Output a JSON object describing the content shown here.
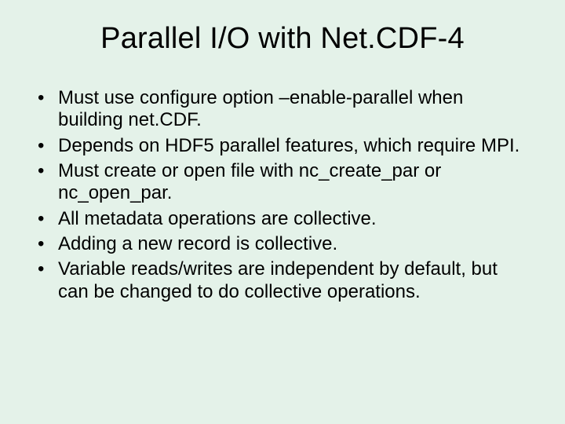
{
  "slide": {
    "title": "Parallel I/O with Net.CDF-4",
    "bullets": [
      "Must use configure option –enable-parallel when building net.CDF.",
      "Depends on HDF5 parallel features, which require MPI.",
      "Must create or open file with nc_create_par or nc_open_par.",
      "All metadata operations are collective.",
      "Adding a new record is collective.",
      "Variable reads/writes are independent by default, but can be changed to do collective operations."
    ]
  }
}
